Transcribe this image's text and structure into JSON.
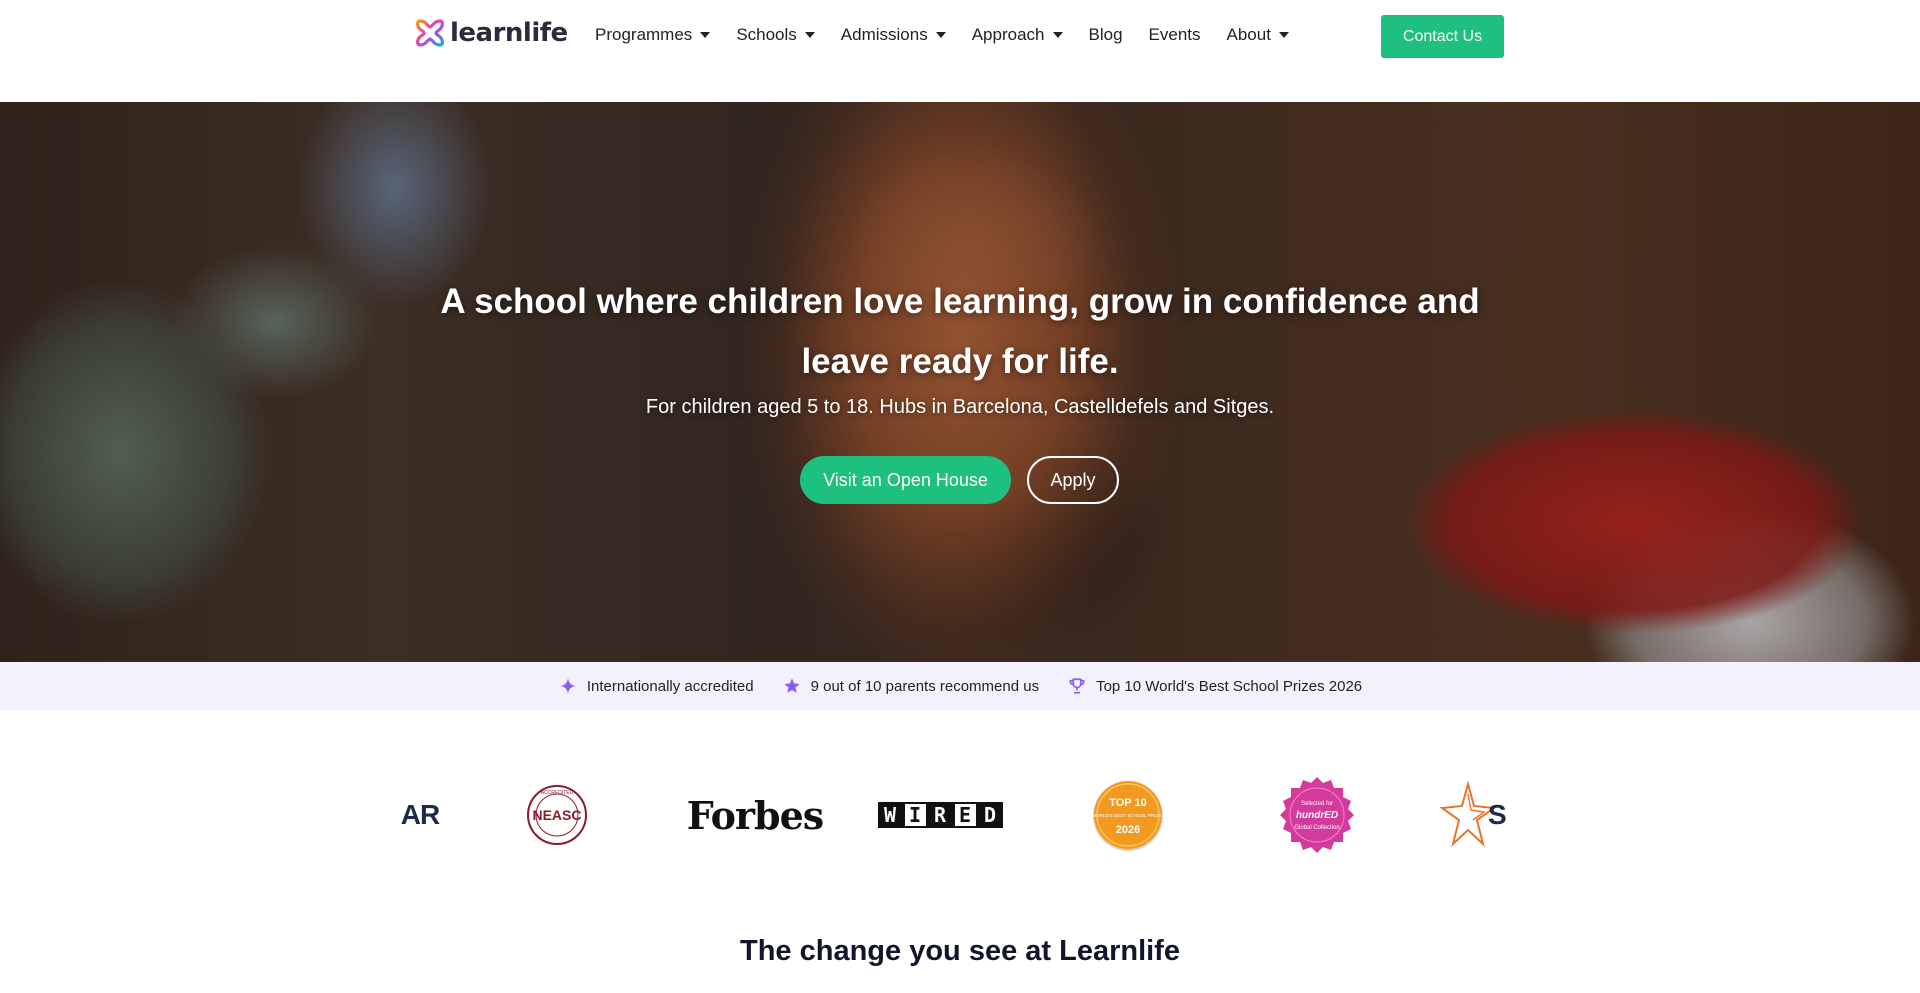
{
  "header": {
    "brand": "learnlife",
    "nav": [
      {
        "label": "Programmes",
        "dropdown": true
      },
      {
        "label": "Schools",
        "dropdown": true
      },
      {
        "label": "Admissions",
        "dropdown": true
      },
      {
        "label": "Approach",
        "dropdown": true
      },
      {
        "label": "Blog",
        "dropdown": false
      },
      {
        "label": "Events",
        "dropdown": false
      },
      {
        "label": "About",
        "dropdown": true
      }
    ],
    "contact_label": "Contact Us"
  },
  "hero": {
    "title": "A school where children love learning, grow in confidence and leave ready for life.",
    "subtitle": "For children aged 5 to 18. Hubs in Barcelona, Castelldefels and Sitges.",
    "primary_cta": "Visit an Open House",
    "secondary_cta": "Apply"
  },
  "badges": [
    {
      "icon": "sparkle-icon",
      "label": "Internationally accredited"
    },
    {
      "icon": "star-icon",
      "label": "9 out of 10 parents recommend us"
    },
    {
      "icon": "trophy-icon",
      "label": "Top 10 World's Best School Prizes 2026"
    }
  ],
  "logos": {
    "partial_left": "AR",
    "neasc": "NEASC",
    "neasc_ring": "ACCREDITED",
    "forbes": "Forbes",
    "wired": [
      "W",
      "I",
      "R",
      "E",
      "D"
    ],
    "top10_line1": "TOP 10",
    "top10_line2": "WORLD'S BEST SCHOOL PRIZES",
    "top10_year": "2026",
    "hundred_line1": "Selected for",
    "hundred_brand": "hundrED",
    "hundred_line2": "Global Collection",
    "partial_right": "S"
  },
  "section": {
    "title": "The change you see at Learnlife"
  },
  "colors": {
    "accent": "#1ec07f",
    "badge_bar": "#f3f1fb",
    "badge_icon": "#8b5cf6",
    "heading": "#12152b"
  }
}
